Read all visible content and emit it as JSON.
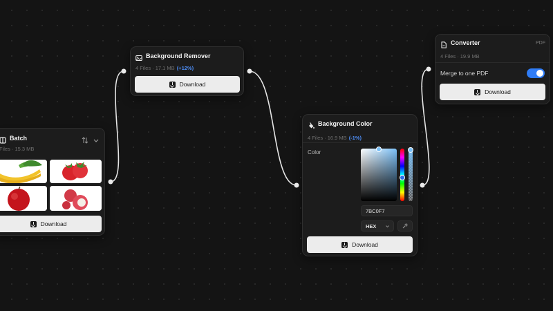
{
  "nodes": {
    "batch": {
      "title": "Batch",
      "subtitle": "Files · 15.3 MB",
      "download_label": "Download",
      "thumbnails": [
        "banana",
        "strawberries",
        "apple",
        "lychee"
      ]
    },
    "remover": {
      "title": "Background Remover",
      "subtitle": "4 Files · 17.1 MB",
      "delta": "(+12%)",
      "download_label": "Download"
    },
    "color": {
      "title": "Background Color",
      "subtitle": "4 Files · 16.9 MB",
      "delta": "(-1%)",
      "color_label": "Color",
      "hex_value": "7BC0F7",
      "format": "HEX",
      "selected_color": "#7BC0F7",
      "download_label": "Download"
    },
    "converter": {
      "title": "Converter",
      "badge": "PDF",
      "subtitle": "4 Files · 19.9 MB",
      "merge_label": "Merge to one PDF",
      "merge_enabled": true,
      "download_label": "Download"
    }
  },
  "colors": {
    "accent": "#2F7CF6",
    "delta": "#4D8EF7",
    "canvas": "#141414",
    "node": "#1C1C1C"
  }
}
